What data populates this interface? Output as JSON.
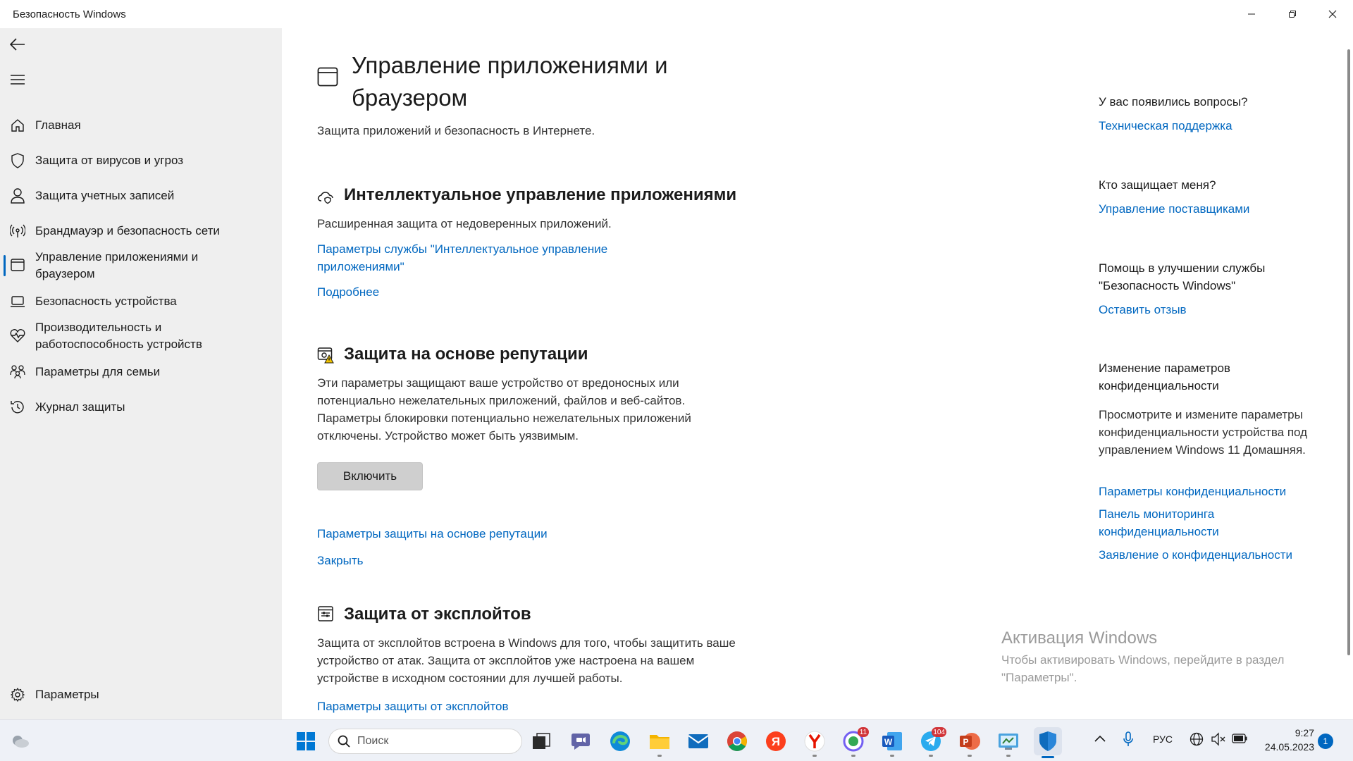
{
  "window": {
    "title": "Безопасность Windows"
  },
  "sidebar": {
    "items": [
      {
        "label": "Главная",
        "icon": "home-icon"
      },
      {
        "label": "Защита от вирусов и угроз",
        "icon": "shield-icon"
      },
      {
        "label": "Защита учетных записей",
        "icon": "person-icon"
      },
      {
        "label": "Брандмауэр и безопасность сети",
        "icon": "antenna-icon"
      },
      {
        "label": "Управление приложениями и браузером",
        "icon": "app-window-icon",
        "active": true
      },
      {
        "label": "Безопасность устройства",
        "icon": "laptop-icon"
      },
      {
        "label": "Производительность и работоспособность устройств",
        "icon": "heart-pulse-icon"
      },
      {
        "label": "Параметры для семьи",
        "icon": "family-icon"
      },
      {
        "label": "Журнал защиты",
        "icon": "history-icon"
      }
    ],
    "settings_label": "Параметры"
  },
  "main": {
    "title": "Управление приложениями и браузером",
    "subtitle": "Защита приложений и безопасность в Интернете.",
    "smart_app": {
      "title": "Интеллектуальное управление приложениями",
      "description": "Расширенная защита от недоверенных приложений.",
      "settings_link": "Параметры службы \"Интеллектуальное управление приложениями\"",
      "more_link": "Подробнее"
    },
    "reputation": {
      "title": "Защита на основе репутации",
      "description": "Эти параметры защищают ваше устройство от вредоносных или потенциально нежелательных приложений, файлов и веб-сайтов. Параметры блокировки потенциально нежелательных приложений отключены. Устройство может быть уязвимым.",
      "enable_button": "Включить",
      "settings_link": "Параметры защиты на основе репутации",
      "dismiss_link": "Закрыть"
    },
    "exploit": {
      "title": "Защита от эксплойтов",
      "description": "Защита от эксплойтов встроена в Windows для того, чтобы защитить ваше устройство от атак.  Защита от эксплойтов уже настроена на вашем устройстве в исходном состоянии для лучшей работы.",
      "settings_link": "Параметры защиты от эксплойтов"
    }
  },
  "right": {
    "questions_heading": "У вас появились вопросы?",
    "support_link": "Техническая поддержка",
    "who_heading": "Кто защищает меня?",
    "providers_link": "Управление поставщиками",
    "improve_heading": "Помощь в улучшении службы \"Безопасность Windows\"",
    "feedback_link": "Оставить отзыв",
    "privacy_heading": "Изменение параметров конфиденциальности",
    "privacy_text": "Просмотрите и измените параметры конфиденциальности устройства под управлением Windows 11 Домашняя.",
    "privacy_settings_link": "Параметры конфиденциальности",
    "privacy_dashboard_link": "Панель мониторинга конфиденциальности",
    "privacy_statement_link": "Заявление о конфиденциальности"
  },
  "activation": {
    "title": "Активация Windows",
    "text": "Чтобы активировать Windows, перейдите в раздел \"Параметры\"."
  },
  "taskbar": {
    "search_placeholder": "Поиск",
    "language": "РУС",
    "time": "9:27",
    "date": "24.05.2023",
    "notification_count": "1",
    "viber_badge": "11",
    "telegram_badge": "104",
    "accent": "#0067c0"
  }
}
